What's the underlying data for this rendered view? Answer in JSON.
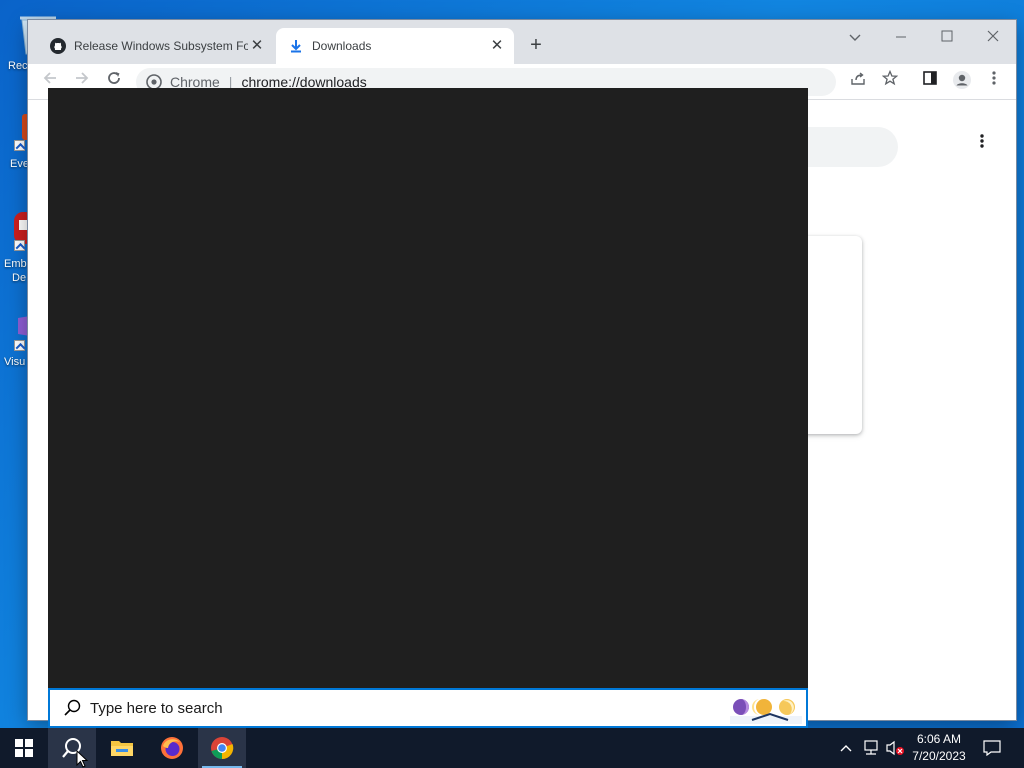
{
  "desktop": {
    "icons": [
      {
        "label": "Rec"
      },
      {
        "label": "Eve"
      },
      {
        "label": "Emb"
      },
      {
        "label": "De"
      },
      {
        "label": "Visu"
      }
    ]
  },
  "browser": {
    "tabs": [
      {
        "title": "Release Windows Subsystem For"
      },
      {
        "title": "Downloads"
      }
    ],
    "omnibox": {
      "scheme": "Chrome",
      "url": "chrome://downloads"
    }
  },
  "search": {
    "placeholder": "Type here to search"
  },
  "taskbar": {
    "clock": {
      "time": "6:06 AM",
      "date": "7/20/2023"
    }
  }
}
